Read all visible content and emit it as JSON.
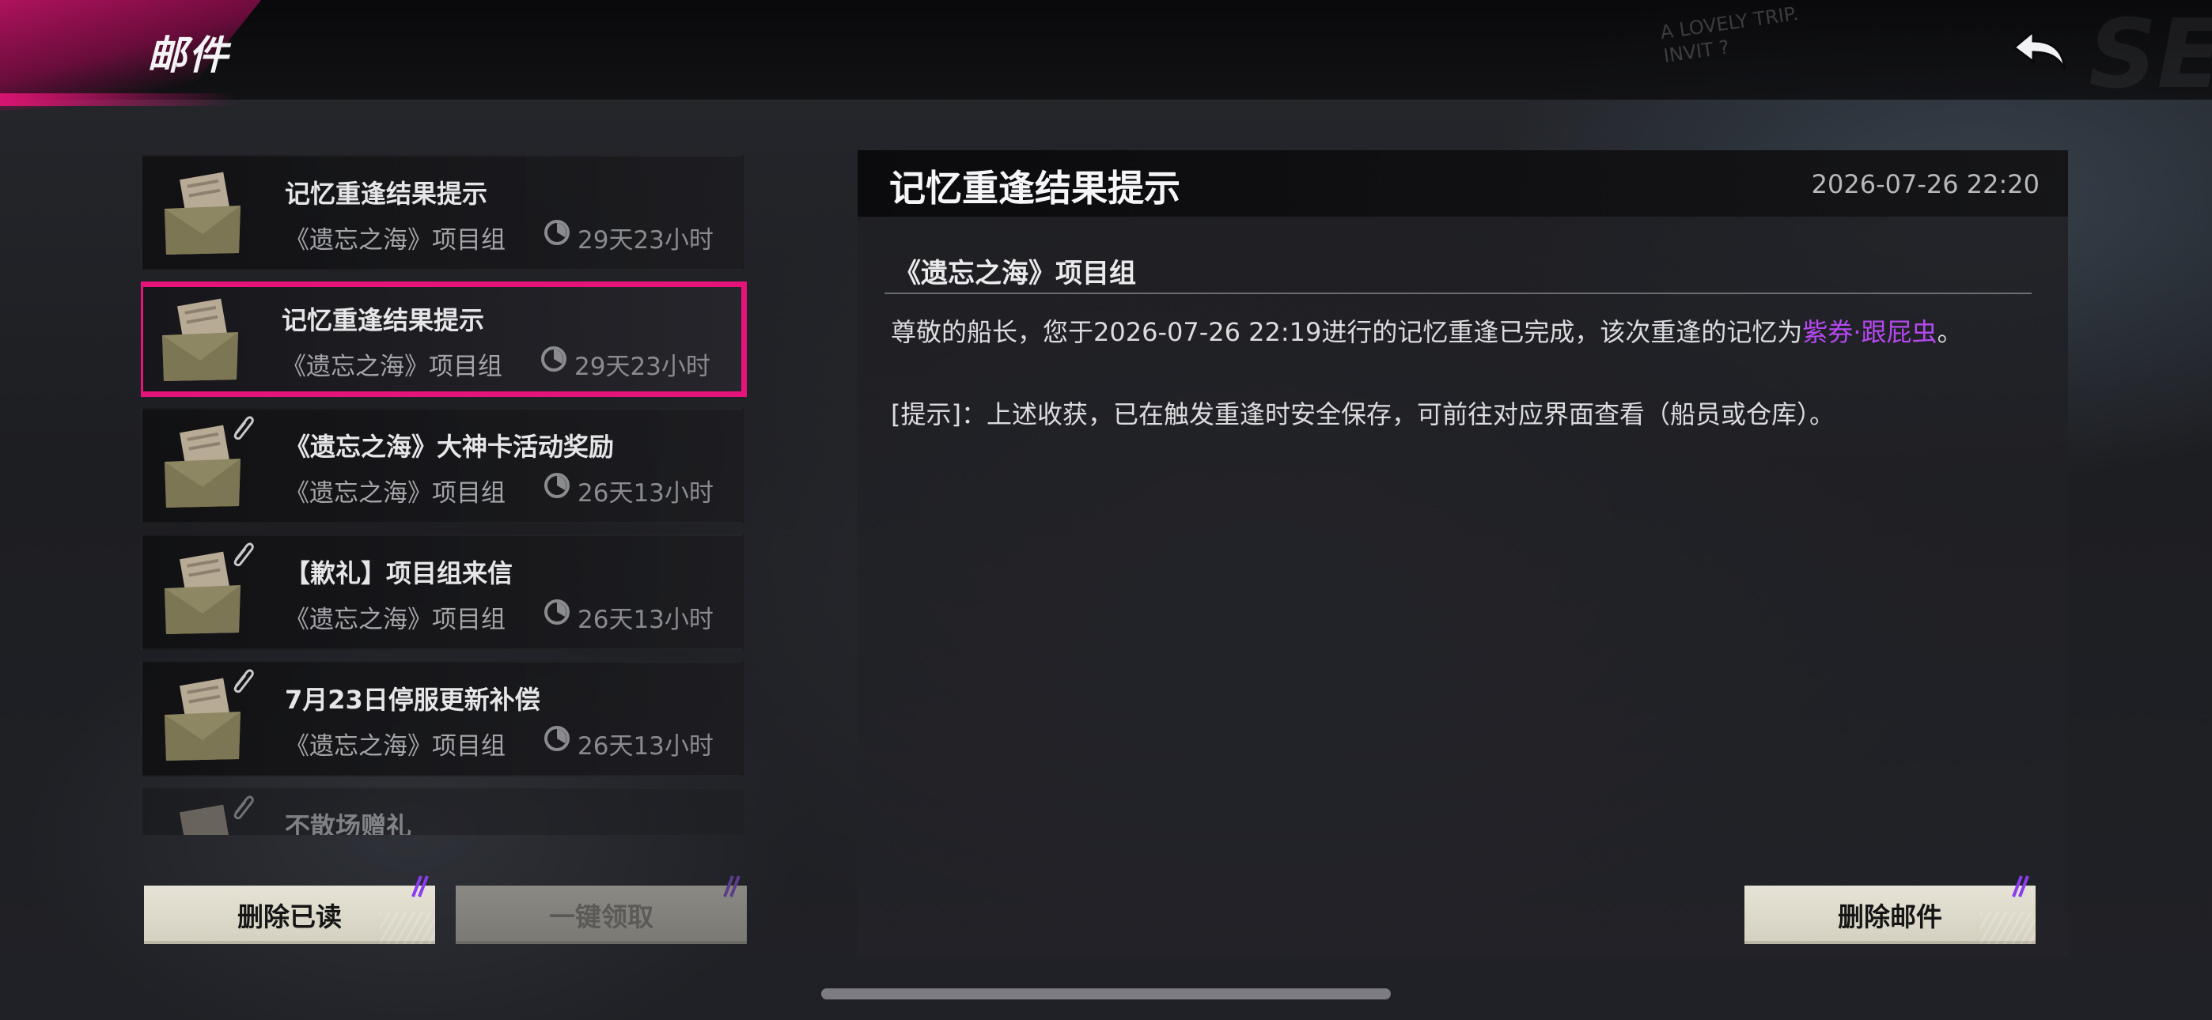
{
  "header": {
    "title": "邮件",
    "scribble": [
      "A LOVELY TRIP.",
      "INVIT ?"
    ],
    "logo_text": "SE"
  },
  "mail_list": {
    "items": [
      {
        "title": "记忆重逢结果提示",
        "sender": "《遗忘之海》项目组",
        "expire": "29天23小时",
        "attachment": false,
        "selected": false
      },
      {
        "title": "记忆重逢结果提示",
        "sender": "《遗忘之海》项目组",
        "expire": "29天23小时",
        "attachment": false,
        "selected": true
      },
      {
        "title": "《遗忘之海》大神卡活动奖励",
        "sender": "《遗忘之海》项目组",
        "expire": "26天13小时",
        "attachment": true,
        "selected": false
      },
      {
        "title": "【歉礼】项目组来信",
        "sender": "《遗忘之海》项目组",
        "expire": "26天13小时",
        "attachment": true,
        "selected": false
      },
      {
        "title": "7月23日停服更新补偿",
        "sender": "《遗忘之海》项目组",
        "expire": "26天13小时",
        "attachment": true,
        "selected": false
      },
      {
        "title": "不散场赠礼",
        "sender": "",
        "expire": "",
        "attachment": true,
        "selected": false
      }
    ]
  },
  "actions": {
    "delete_read": "删除已读",
    "claim_all": "一键领取",
    "delete_mail": "删除邮件"
  },
  "detail": {
    "title": "记忆重逢结果提示",
    "date": "2026-07-26 22:20",
    "sender": "《遗忘之海》项目组",
    "body_line1_prefix": "尊敬的船长，您于2026-07-26 22:19进行的记忆重逢已完成，该次重逢的记忆为",
    "body_line1_highlight": "紫券·跟屁虫",
    "body_line1_suffix": "。",
    "body_line2": "[提示]：上述收获，已在触发重逢时安全保存，可前往对应界面查看（船员或仓库）。"
  },
  "colors": {
    "accent_pink": "#e4147a",
    "highlight_purple": "#b548f0",
    "button_face": "#e6e3d6"
  },
  "icons": {
    "back": "back-arrow-icon",
    "envelope": "envelope-icon",
    "attachment": "paperclip-icon",
    "expire": "clock-icon"
  }
}
